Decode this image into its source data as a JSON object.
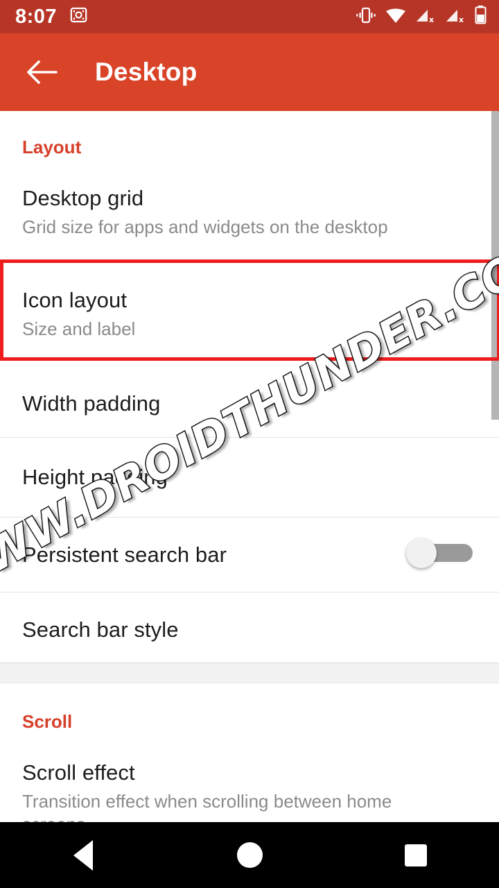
{
  "status_bar": {
    "time": "8:07",
    "left_icons": [
      {
        "name": "screenshot-icon",
        "glyph": "screenshot"
      }
    ],
    "right_icons": [
      {
        "name": "vibrate-icon",
        "glyph": "vibrate"
      },
      {
        "name": "wifi-icon",
        "glyph": "wifi"
      },
      {
        "name": "signal-sim1-no-service-icon",
        "glyph": "signal-x"
      },
      {
        "name": "signal-sim2-no-service-icon",
        "glyph": "signal-x"
      },
      {
        "name": "battery-icon",
        "glyph": "battery"
      }
    ],
    "background_color": "#b63526",
    "foreground_color": "#ffffff"
  },
  "toolbar": {
    "back_label": "Back",
    "title": "Desktop",
    "background_color": "#d94428",
    "foreground_color": "#ffffff"
  },
  "accent_color": "#d6402a",
  "highlight_color": "#ee1c1c",
  "watermark": {
    "text": "WWW.DROIDTHUNDER.COM"
  },
  "sections": [
    {
      "header": "Layout",
      "items": [
        {
          "title": "Desktop grid",
          "subtitle": "Grid size for apps and widgets on the desktop",
          "type": "navigate",
          "highlighted": false
        },
        {
          "title": "Icon layout",
          "subtitle": "Size and label",
          "type": "navigate",
          "highlighted": true
        },
        {
          "title": "Width padding",
          "subtitle": "",
          "type": "navigate",
          "highlighted": false
        },
        {
          "title": "Height padding",
          "subtitle": "",
          "type": "navigate",
          "highlighted": false
        },
        {
          "title": "Persistent search bar",
          "subtitle": "",
          "type": "switch",
          "switch_state": "off",
          "highlighted": false
        },
        {
          "title": "Search bar style",
          "subtitle": "",
          "type": "navigate",
          "highlighted": false
        }
      ]
    },
    {
      "header": "Scroll",
      "items": [
        {
          "title": "Scroll effect",
          "subtitle": "Transition effect when scrolling between home screens",
          "type": "navigate",
          "highlighted": false
        }
      ]
    }
  ],
  "nav_bar": {
    "back_label": "Back",
    "home_label": "Home",
    "recents_label": "Recents"
  }
}
